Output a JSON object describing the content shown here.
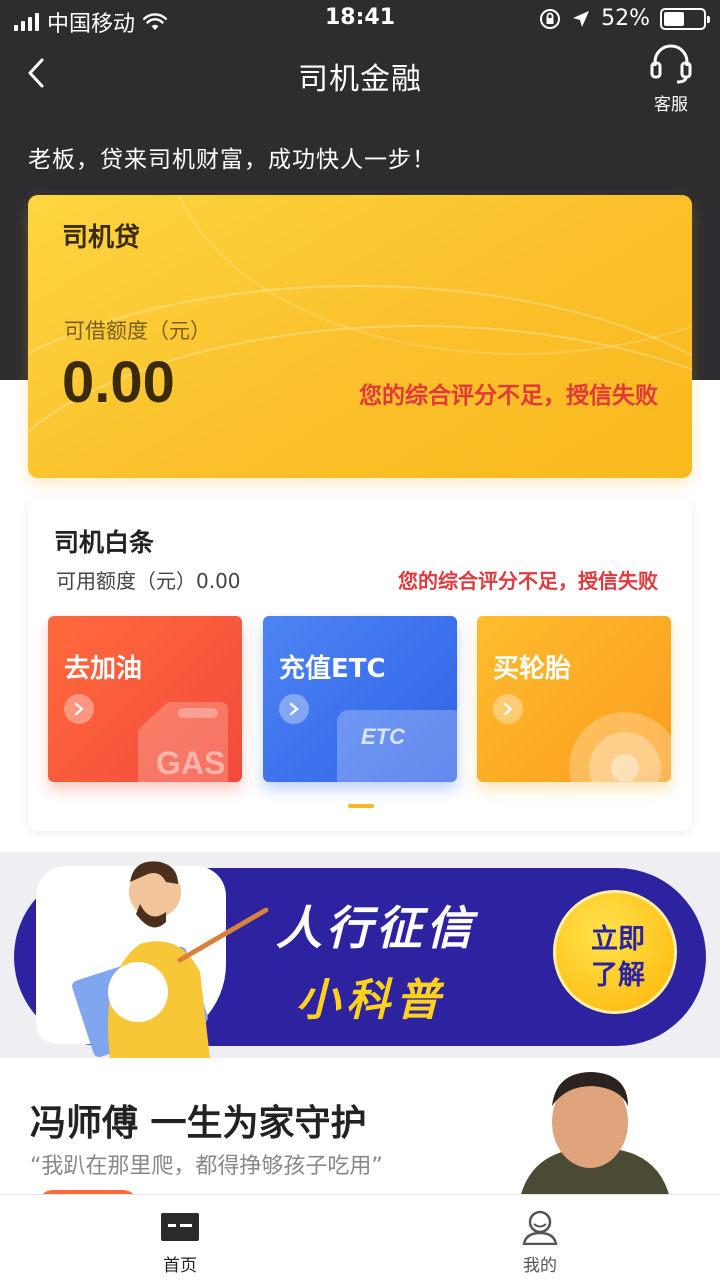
{
  "status_bar": {
    "carrier": "中国移动",
    "time": "18:41",
    "battery": "52%"
  },
  "nav": {
    "title": "司机金融",
    "service_label": "客服"
  },
  "slogan": "老板，贷来司机财富，成功快人一步！",
  "loan_card": {
    "title": "司机贷",
    "limit_label": "可借额度（元）",
    "amount": "0.00",
    "status": "您的综合评分不足，授信失败"
  },
  "credit_card": {
    "title": "司机白条",
    "limit_text": "可用额度（元）0.00",
    "status": "您的综合评分不足，授信失败",
    "tiles": [
      {
        "label": "去加油",
        "badge": "GAS"
      },
      {
        "label": "充值ETC",
        "badge": "ETC"
      },
      {
        "label": "买轮胎"
      }
    ]
  },
  "banner": {
    "title": "人行征信",
    "subtitle": "小科普",
    "button_line1": "立即",
    "button_line2": "了解"
  },
  "story": {
    "title": "冯师傅  一生为家守护",
    "quote": "“我趴在那里爬，都得挣够孩子吃用”"
  },
  "tabs": [
    {
      "label": "首页"
    },
    {
      "label": "我的"
    }
  ],
  "colors": {
    "dark_header": "#2d2d30",
    "loan_card_yellow": "#fbc02b",
    "fail_red": "#e2393e",
    "gas_tile": "#f34a3b",
    "etc_tile": "#2f62e8",
    "tire_tile": "#fb9d1e",
    "banner_blue": "#2d22a0",
    "banner_yellow": "#ffd21c"
  },
  "icons": {
    "back": "chevron-left-icon",
    "service": "headset-icon",
    "home_tab": "wallet-icon",
    "mine_tab": "user-icon"
  }
}
